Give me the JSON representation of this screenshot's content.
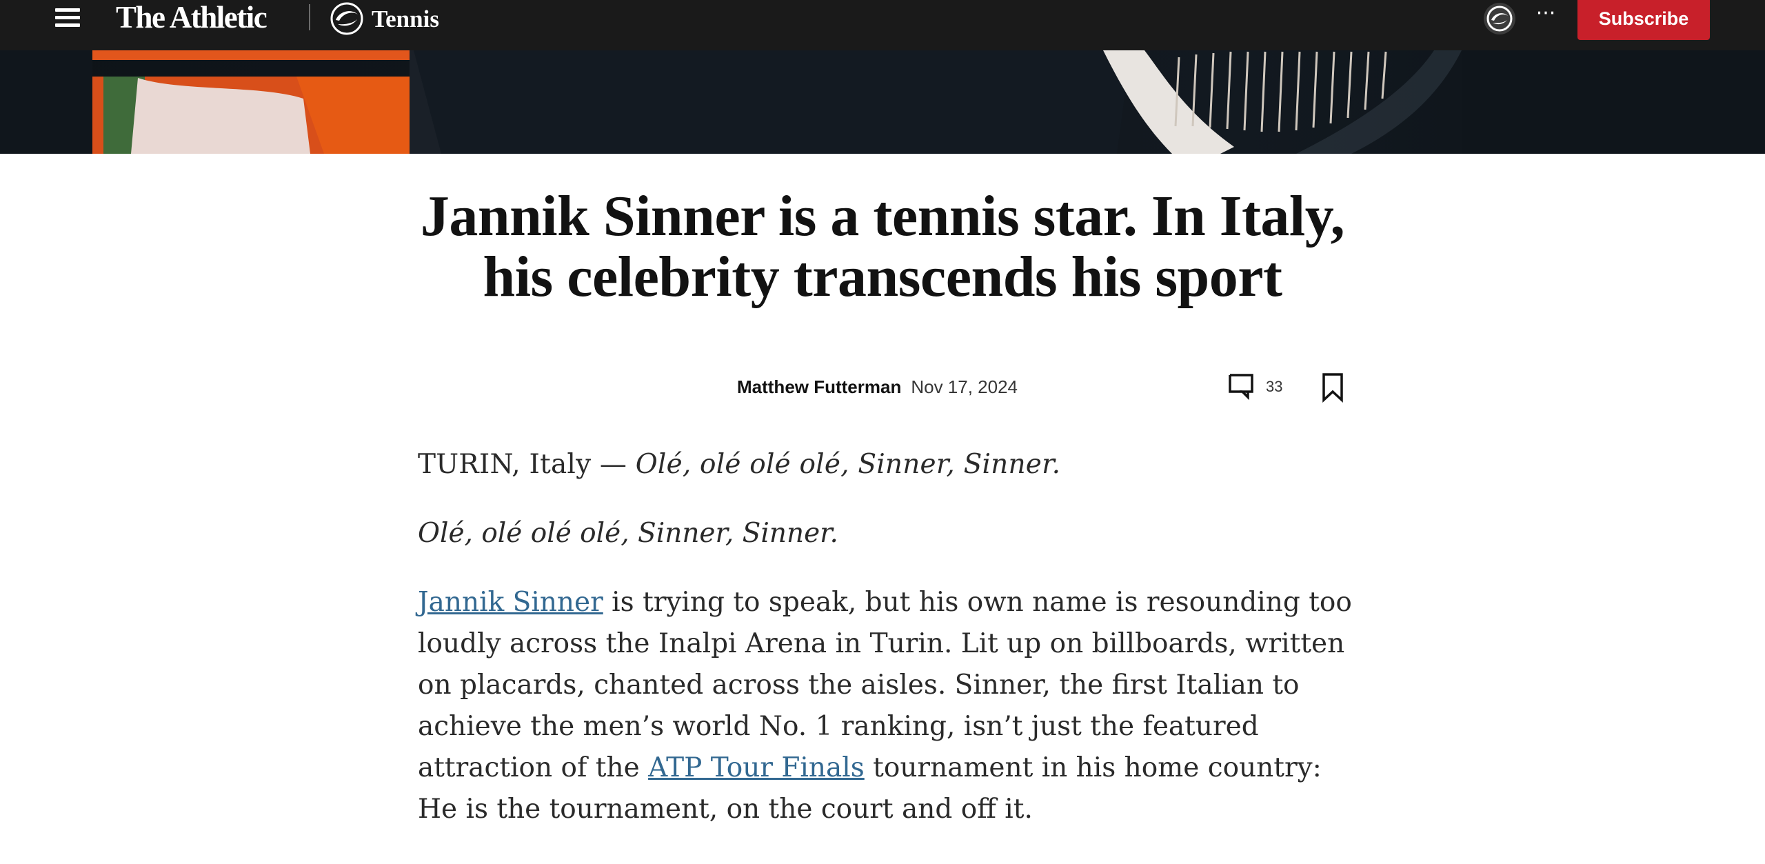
{
  "nav": {
    "logo": "The Athletic",
    "section": "Tennis",
    "subscribe_label": "Subscribe",
    "icons": [
      "hamburger-menu-icon",
      "athletic-section-logo-icon",
      "account-icon",
      "more-icon"
    ]
  },
  "article": {
    "headline": "Jannik Sinner is a tennis star. In Italy, his celebrity transcends his sport",
    "author": "Matthew Futterman",
    "date": "Nov 17, 2024",
    "comment_count": "33",
    "dateline_prefix": "TURIN, Italy — ",
    "chant_1": "Olé, olé olé olé, Sinner, Sinner.",
    "chant_2": "Olé, olé olé olé, Sinner, Sinner.",
    "link_sinner": "Jannik Sinner",
    "para_1a": " is trying to speak, but his own name is resounding too loudly across the Inalpi Arena in Turin. Lit up on billboards, written on placards, chanted across the aisles. Sinner, the first Italian to achieve the men’s world No. 1 ranking, isn’t just the featured attraction of the ",
    "link_atp": "ATP Tour Finals",
    "para_1b": " tournament in his home country: He is the tournament, on the court and off it."
  },
  "colors": {
    "nav_background": "#1a1a1a",
    "subscribe": "#c8202a",
    "link": "#326891"
  }
}
